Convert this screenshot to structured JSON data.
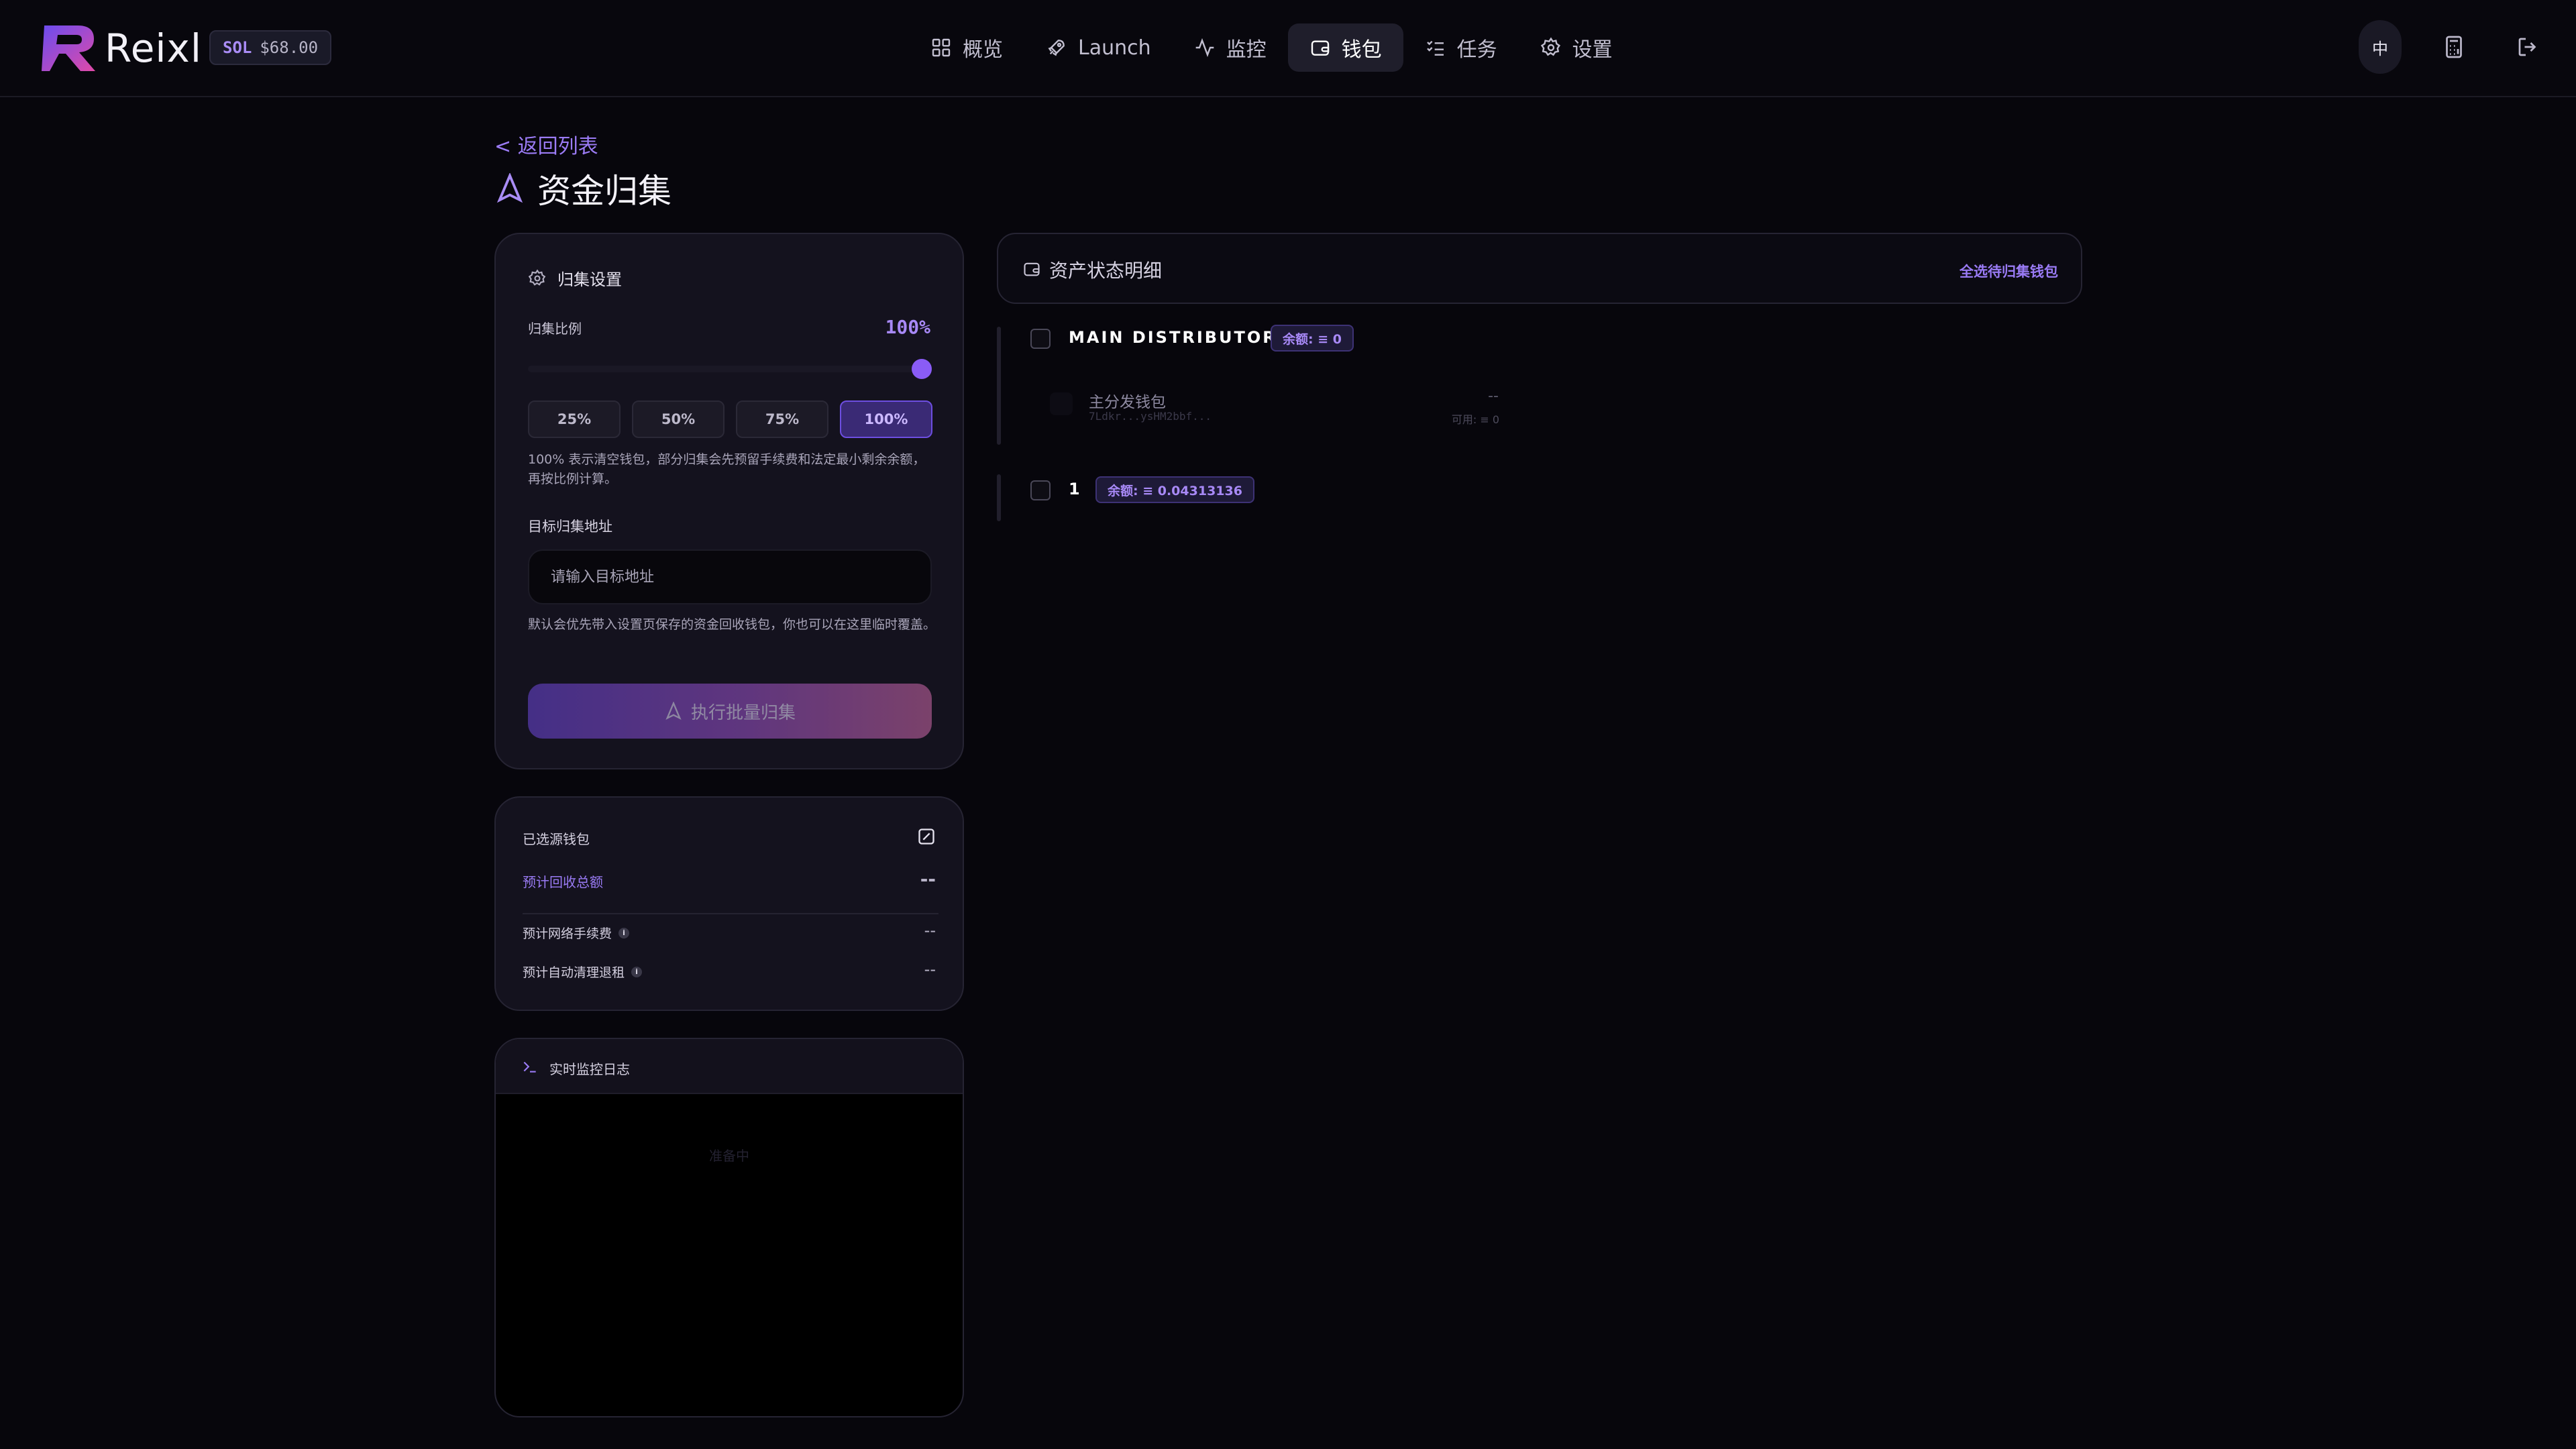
{
  "app": {
    "brand": "Reixl",
    "price": {
      "symbol": "SOL",
      "value": "$68.00"
    },
    "colors": {
      "accent": "#8a5cf6",
      "accent_text": "#a889f7",
      "background": "#07060c"
    }
  },
  "nav": {
    "items": [
      {
        "label": "概览",
        "icon": "grid-icon"
      },
      {
        "label": "Launch",
        "icon": "rocket-icon"
      },
      {
        "label": "监控",
        "icon": "activity-icon"
      },
      {
        "label": "钱包",
        "icon": "wallet-icon",
        "active": true
      },
      {
        "label": "任务",
        "icon": "checklist-icon"
      },
      {
        "label": "设置",
        "icon": "gear-icon"
      }
    ]
  },
  "header_right": {
    "lang": "中",
    "calculator_icon": "calculator-icon",
    "logout_icon": "logout-icon"
  },
  "page": {
    "back": "< 返回列表",
    "title": "资金归集",
    "title_icon": "navigation-icon"
  },
  "settings": {
    "title": "归集设置",
    "ratio_label": "归集比例",
    "ratio_value": "100%",
    "slider_level": 1.0,
    "presets": [
      "25%",
      "50%",
      "75%",
      "100%"
    ],
    "preset_selected": "100%",
    "hint": "100% 表示清空钱包，部分归集会先预留手续费和法定最小剩余余额，再按比例计算。",
    "target_label": "目标归集地址",
    "target_placeholder": "请输入目标地址",
    "target_hint": "默认会优先带入设置页保存的资金回收钱包，你也可以在这里临时覆盖。",
    "execute_label": "执行批量归集"
  },
  "summary": {
    "title": "已选源钱包",
    "total_label": "预计回收总额",
    "total_value": "--",
    "fee_label": "预计网络手续费",
    "fee_value": "--",
    "rent_label": "预计自动清理退租",
    "rent_value": "--",
    "info_mark": "i"
  },
  "log": {
    "title": "实时监控日志",
    "empty": "准备中"
  },
  "assets": {
    "title": "资产状态明细",
    "select_all": "全选待归集钱包",
    "groups": [
      {
        "name": "MAIN DISTRIBUTOR",
        "balance": "余额: ≡ 0",
        "wallets": [
          {
            "name": "主分发钱包",
            "address": "7Ldkr...ysHM2bbf...",
            "value": "--",
            "available": "可用: ≡ 0"
          }
        ]
      },
      {
        "name": "1",
        "balance": "余额: ≡ 0.04313136",
        "wallets": []
      }
    ]
  }
}
